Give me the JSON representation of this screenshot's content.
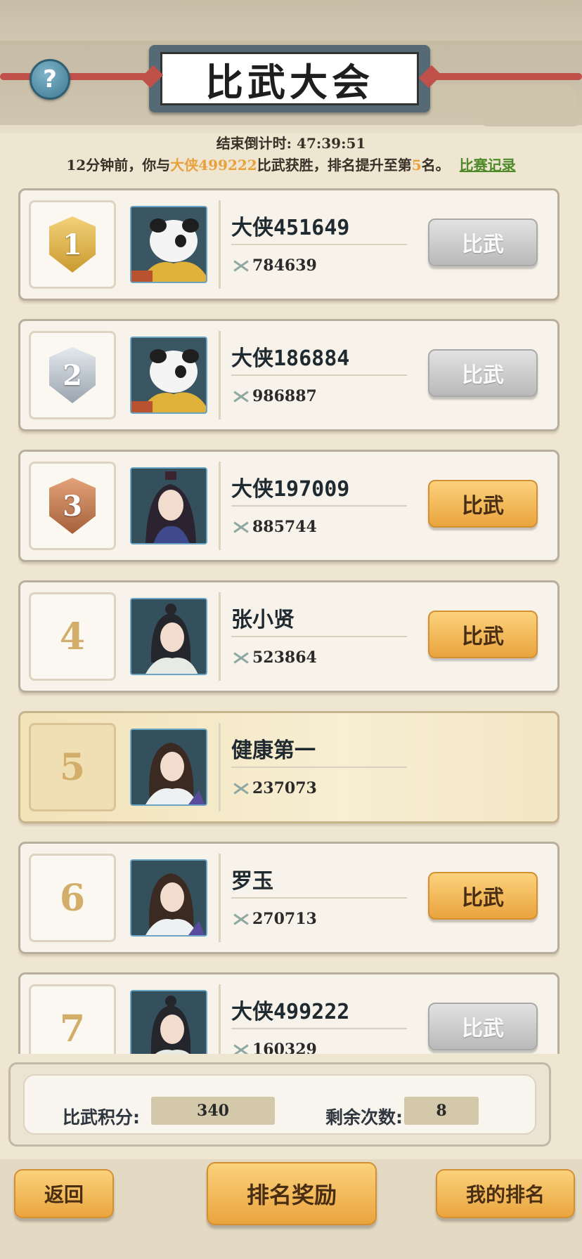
{
  "header": {
    "title": "比武大会",
    "help_glyph": "?"
  },
  "status": {
    "countdown_label": "结束倒计时: 47:39:51",
    "notice_prefix": "12分钟前，你与",
    "notice_opponent": "大侠499222",
    "notice_mid": "比武获胜，排名提升至第",
    "notice_rank": "5",
    "notice_suffix": "名。",
    "record_link": "比赛记录"
  },
  "ranking": [
    {
      "rank": "1",
      "medal": "gold",
      "name": "大侠451649",
      "power": "784639",
      "button": "比武",
      "button_state": "disabled",
      "avatar": "panda"
    },
    {
      "rank": "2",
      "medal": "silver",
      "name": "大侠186884",
      "power": "986887",
      "button": "比武",
      "button_state": "disabled",
      "avatar": "panda"
    },
    {
      "rank": "3",
      "medal": "bronze",
      "name": "大侠197009",
      "power": "885744",
      "button": "比武",
      "button_state": "enabled",
      "avatar": "female-warrior"
    },
    {
      "rank": "4",
      "medal": "",
      "name": "张小贤",
      "power": "523864",
      "button": "比武",
      "button_state": "enabled",
      "avatar": "swordsman-topknot"
    },
    {
      "rank": "5",
      "medal": "",
      "name": "健康第一",
      "power": "237073",
      "button": "",
      "button_state": "self",
      "avatar": "swordsman-longhair"
    },
    {
      "rank": "6",
      "medal": "",
      "name": "罗玉",
      "power": "270713",
      "button": "比武",
      "button_state": "enabled",
      "avatar": "swordsman-longhair"
    },
    {
      "rank": "7",
      "medal": "",
      "name": "大侠499222",
      "power": "160329",
      "button": "比武",
      "button_state": "disabled",
      "avatar": "swordsman-topknot"
    }
  ],
  "stats": {
    "score_label": "比武积分:",
    "score_value": "340",
    "remaining_label": "剩余次数:",
    "remaining_value": "8"
  },
  "footer": {
    "back": "返回",
    "rewards": "排名奖励",
    "my_rank": "我的排名"
  },
  "colors": {
    "gold": "#e3b43f",
    "silver": "#b8c0c8",
    "bronze": "#c27a48",
    "button_enabled": "#f2b555",
    "button_disabled": "#c4c4c4",
    "highlight": "#e8a13c",
    "link": "#4f8a2a"
  }
}
